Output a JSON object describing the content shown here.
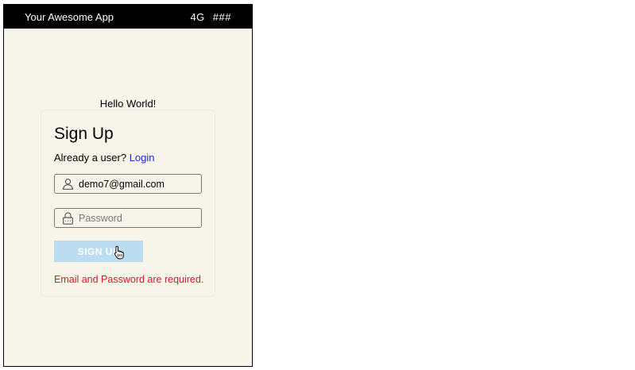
{
  "statusbar": {
    "app_title": "Your Awesome App",
    "network": "4G",
    "signal": "###"
  },
  "greeting": "Hello World!",
  "signup": {
    "title": "Sign Up",
    "already_text": "Already a user?",
    "login_link": "Login",
    "email_value": "demo7@gmail.com",
    "email_icon": "user-icon",
    "password_placeholder": "Password",
    "password_icon": "lock-icon",
    "submit_label": "SIGN UP",
    "error_message": "Email and Password are required."
  },
  "colors": {
    "background": "#f7f5ea",
    "statusbar": "#000000",
    "link": "#1a2bb8",
    "button": "#bcdcf2",
    "error": "#d7192a"
  }
}
